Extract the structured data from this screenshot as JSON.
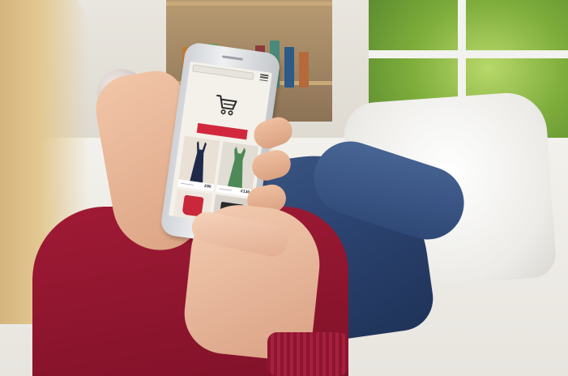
{
  "phone_screen": {
    "products": [
      {
        "price": "£90",
        "color": "#1f2a4a"
      },
      {
        "price": "£130",
        "color": "#4e8a58"
      },
      {
        "price": "",
        "color": "#c8283a"
      },
      {
        "price": "",
        "color": "#2a2a2a"
      }
    ],
    "accent_color": "#d2283e",
    "icons": [
      "cart-icon",
      "menu-icon"
    ]
  }
}
